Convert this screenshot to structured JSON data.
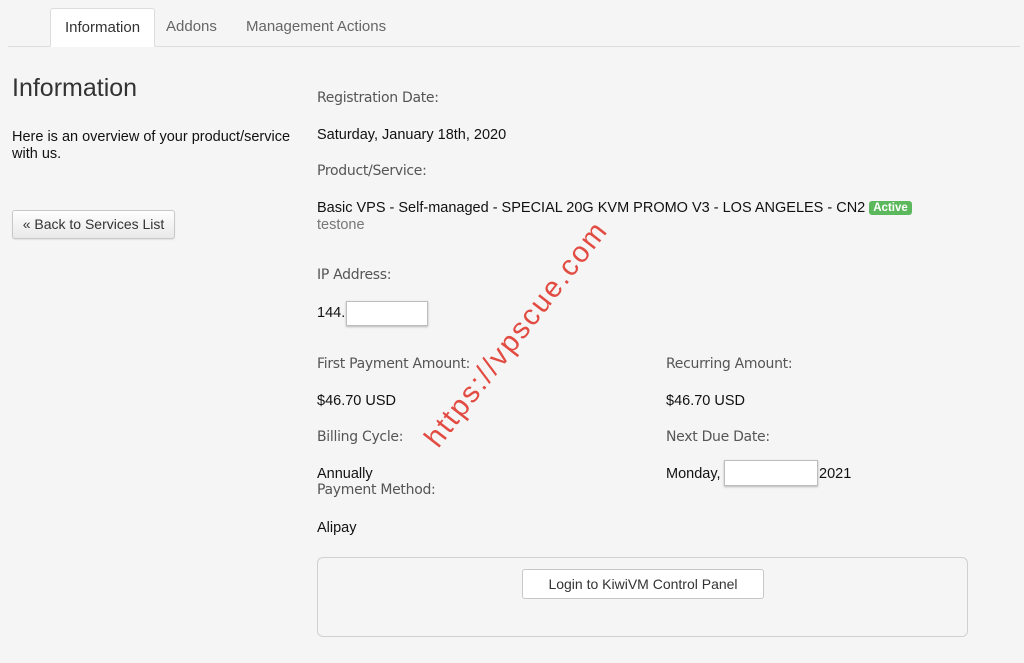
{
  "tabs": [
    {
      "label": "Information",
      "active": true
    },
    {
      "label": "Addons",
      "active": false
    },
    {
      "label": "Management Actions",
      "active": false
    }
  ],
  "left": {
    "title": "Information",
    "description": "Here is an overview of your product/service with us.",
    "back_button": "« Back to Services List"
  },
  "details": {
    "registration_date_label": "Registration Date:",
    "registration_date": "Saturday, January 18th, 2020",
    "product_label": "Product/Service:",
    "product_name": "Basic VPS - Self-managed - SPECIAL 20G KVM PROMO V3 - LOS ANGELES - CN2",
    "status": "Active",
    "hostname": "testone",
    "ip_label": "IP Address:",
    "ip_prefix": "144.",
    "first_payment_label": "First Payment Amount:",
    "first_payment": "$46.70 USD",
    "recurring_label": "Recurring Amount:",
    "recurring": "$46.70 USD",
    "billing_cycle_label": "Billing Cycle:",
    "billing_cycle": "Annually",
    "next_due_label": "Next Due Date:",
    "next_due_prefix": "Monday,",
    "next_due_suffix": "2021",
    "payment_method_label": "Payment Method:",
    "payment_method": "Alipay"
  },
  "actions": {
    "login_button": "Login to KiwiVM Control Panel"
  },
  "watermark": "https://vpscue.com",
  "colors": {
    "status_active": "#5cb85c",
    "watermark": "#e0392f"
  }
}
